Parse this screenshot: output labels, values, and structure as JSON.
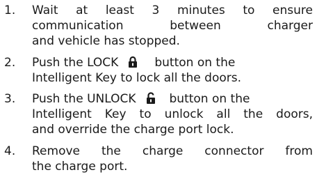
{
  "steps": [
    {
      "number": "1.",
      "lines": [
        "Wait at least 3 minutes to ensure",
        "communication between charger",
        "and vehicle has stopped."
      ]
    },
    {
      "number": "2.",
      "line1_before_icon": "Push the LOCK",
      "lock_icon": "padlock-closed-icon",
      "line1_after_icon": "button on the",
      "line2": "Intelligent Key to lock all the doors."
    },
    {
      "number": "3.",
      "line1_before_icon": "Push the UNLOCK",
      "unlock_icon": "padlock-open-icon",
      "line1_after_icon": "button on the",
      "line2": "Intelligent Key to unlock all the doors,",
      "line3": "and override the charge port lock."
    },
    {
      "number": "4.",
      "lines": [
        "Remove the charge connector from",
        "the charge port."
      ]
    }
  ]
}
